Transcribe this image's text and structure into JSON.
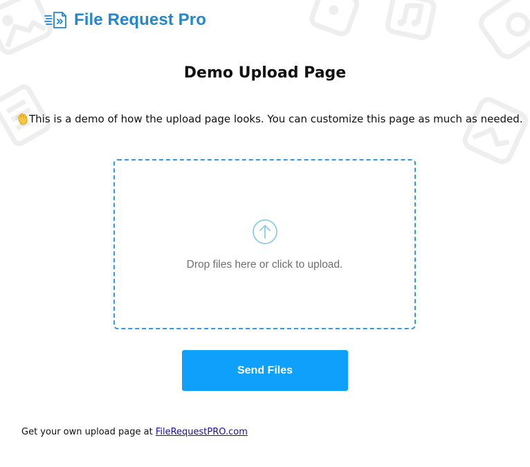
{
  "brand": {
    "name": "File Request Pro",
    "icon": "file-request-logo-icon",
    "color": "#1e88d2"
  },
  "page": {
    "title": "Demo Upload Page",
    "intro_icon": "waving-hand-icon",
    "intro_text": "This is a demo of how the upload page looks. You can customize this page as much as needed."
  },
  "dropzone": {
    "icon": "upload-arrow-icon",
    "text": "Drop files here or click to upload.",
    "border_color": "#2f9be6"
  },
  "actions": {
    "send_label": "Send Files",
    "button_color": "#0fa0fb"
  },
  "footer": {
    "prefix": "Get your own upload page at ",
    "link_text": "FileRequestPRO.com"
  },
  "background": {
    "decoration_icons": [
      "image-icon",
      "music-icon",
      "camera-icon",
      "document-icon"
    ]
  }
}
